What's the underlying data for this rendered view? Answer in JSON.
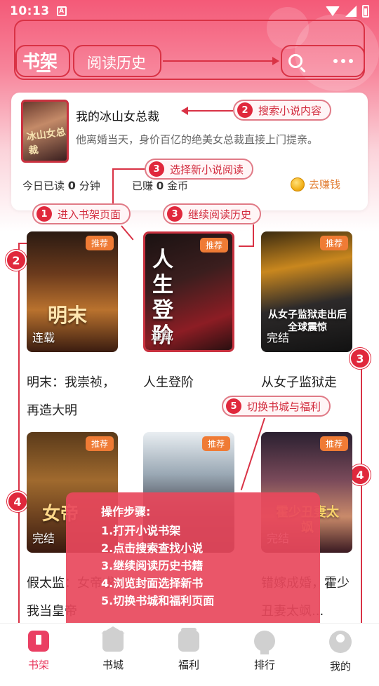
{
  "status_bar": {
    "time": "10:13",
    "notification_glyph": "A"
  },
  "header": {
    "tabs": [
      {
        "label": "书架",
        "active": true
      },
      {
        "label": "阅读历史",
        "active": false
      }
    ],
    "search_icon": "search-icon",
    "more_icon": "more-icon"
  },
  "continue_reading": {
    "cover_text": "冰山女总裁",
    "title": "我的冰山女总裁",
    "description": "他离婚当天，身价百亿的绝美女总裁直接上门提亲。",
    "today_read_prefix": "今日已读",
    "today_read_value": "0",
    "today_read_unit": "分钟",
    "earned_prefix": "已赚",
    "earned_value": "0",
    "earned_unit": "金币",
    "earn_button": "去赚钱"
  },
  "books": [
    {
      "title": "明末：我崇祯，再造大明",
      "tag": "推荐",
      "cover_text": "明末",
      "cover_status": "连载"
    },
    {
      "title": "人生登阶",
      "tag": "推荐",
      "cover_text": "人生登阶",
      "cover_status": "连载"
    },
    {
      "title": "从女子监狱走",
      "tag": "推荐",
      "cover_text": "从女子监狱走出后 全球震惊",
      "cover_status": "完结"
    },
    {
      "title": "假太监：女帝求我当皇帝",
      "tag": "推荐",
      "cover_text": "女帝",
      "cover_status": "完结"
    },
    {
      "title": "",
      "tag": "推荐",
      "cover_text": "",
      "cover_status": ""
    },
    {
      "title": "错嫁成婚，霍少丑妻太飒...",
      "tag": "推荐",
      "cover_text": "霍少丑妻太飒",
      "cover_status": "完结"
    }
  ],
  "annotations": {
    "callouts": [
      {
        "num": "2",
        "text": "搜索小说内容"
      },
      {
        "num": "3",
        "text": "选择新小说阅读"
      },
      {
        "num": "1",
        "text": "进入书架页面"
      },
      {
        "num": "3",
        "text": "继续阅读历史"
      },
      {
        "num": "5",
        "text": "切换书城与福利"
      }
    ],
    "badges": [
      "2",
      "3",
      "4",
      "4"
    ]
  },
  "steps": {
    "title": "操作步骤:",
    "items": [
      "1.打开小说书架",
      "2.点击搜索查找小说",
      "3.继续阅读历史书籍",
      "4.浏览封面选择新书",
      "5.切换书城和福利页面"
    ]
  },
  "bottom_nav": [
    {
      "label": "书架",
      "icon": "bookshelf-icon",
      "active": true
    },
    {
      "label": "书城",
      "icon": "bookstore-icon",
      "active": false
    },
    {
      "label": "福利",
      "icon": "gift-icon",
      "active": false
    },
    {
      "label": "排行",
      "icon": "ranking-icon",
      "active": false
    },
    {
      "label": "我的",
      "icon": "profile-icon",
      "active": false
    }
  ],
  "colors": {
    "accent": "#e8345a",
    "annotation": "#d93245",
    "tag": "#ef7b35",
    "earn": "#e3823a"
  }
}
